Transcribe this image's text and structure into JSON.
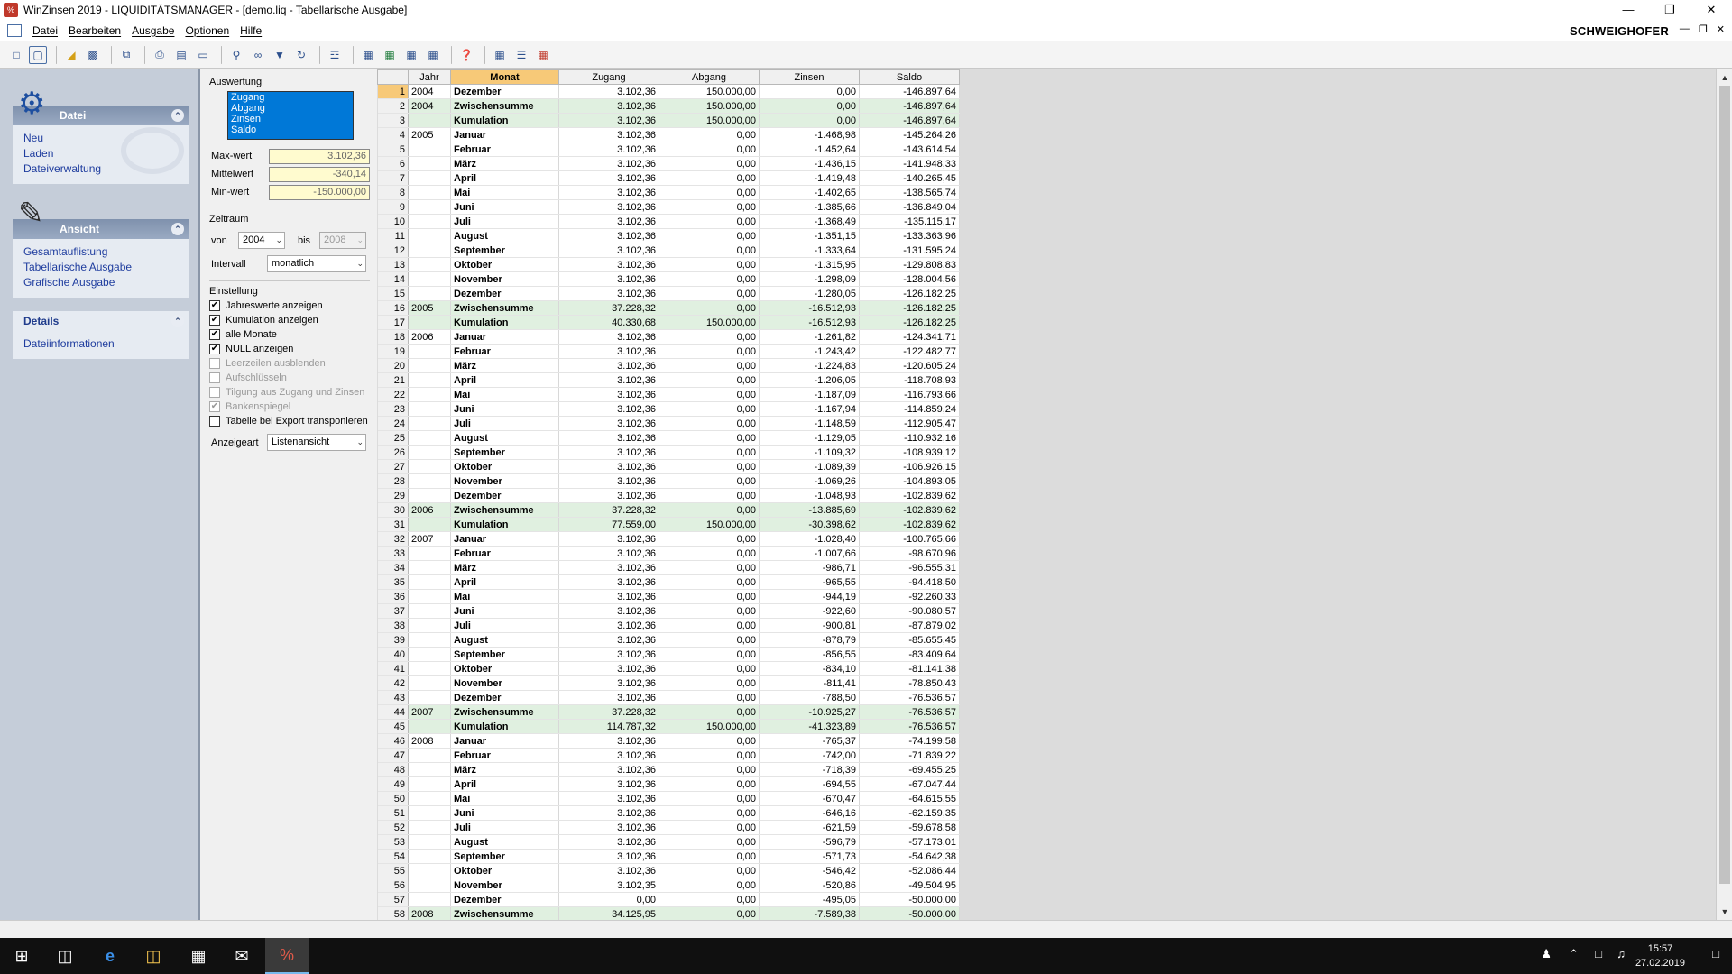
{
  "window": {
    "title": "WinZinsen 2019 - LIQUIDITÄTSMANAGER - [demo.liq - Tabellarische Ausgabe]",
    "app_icon": "%"
  },
  "menu": [
    "Datei",
    "Bearbeiten",
    "Ausgabe",
    "Optionen",
    "Hilfe"
  ],
  "brand": "SCHWEIGHOFER",
  "toolbar_icons": [
    "new-document-icon",
    "page-icon",
    "open-folder-icon",
    "save-icon",
    "copy-icon",
    "print-icon",
    "print-preview-icon",
    "page-setup-icon",
    "search-icon",
    "glasses-icon",
    "filter-icon",
    "refresh-icon",
    "tree-icon",
    "export-icon",
    "excel-export-icon",
    "word-export-icon",
    "pdf-export-icon",
    "help-icon",
    "table-view-icon",
    "list-view-icon",
    "grid-view-icon"
  ],
  "taskpane": {
    "datei": {
      "title": "Datei",
      "items": [
        "Neu",
        "Laden",
        "Dateiverwaltung"
      ]
    },
    "ansicht": {
      "title": "Ansicht",
      "items": [
        "Gesamtauflistung",
        "Tabellarische Ausgabe",
        "Grafische Ausgabe"
      ]
    },
    "details": {
      "title": "Details",
      "items": [
        "Dateiinformationen"
      ]
    }
  },
  "settings": {
    "auswertung_label": "Auswertung",
    "auswertung_items": [
      "Zugang",
      "Abgang",
      "Zinsen",
      "Saldo"
    ],
    "max_label": "Max-wert",
    "max_value": "3.102,36",
    "mittel_label": "Mittelwert",
    "mittel_value": "-340,14",
    "min_label": "Min-wert",
    "min_value": "-150.000,00",
    "zeitraum_label": "Zeitraum",
    "von_label": "von",
    "von_value": "2004",
    "bis_label": "bis",
    "bis_value": "2008",
    "intervall_label": "Intervall",
    "intervall_value": "monatlich",
    "einstellung_label": "Einstellung",
    "checkboxes": [
      {
        "label": "Jahreswerte anzeigen",
        "checked": true,
        "disabled": false
      },
      {
        "label": "Kumulation anzeigen",
        "checked": true,
        "disabled": false
      },
      {
        "label": "alle Monate",
        "checked": true,
        "disabled": false
      },
      {
        "label": "NULL anzeigen",
        "checked": true,
        "disabled": false
      },
      {
        "label": "Leerzeilen ausblenden",
        "checked": false,
        "disabled": true
      },
      {
        "label": "Aufschlüsseln",
        "checked": false,
        "disabled": true
      },
      {
        "label": "Tilgung aus Zugang und Zinsen",
        "checked": false,
        "disabled": true
      },
      {
        "label": "Bankenspiegel",
        "checked": true,
        "disabled": true
      },
      {
        "label": "Tabelle bei Export transponieren",
        "checked": false,
        "disabled": false
      }
    ],
    "anzeigeart_label": "Anzeigeart",
    "anzeigeart_value": "Listenansicht"
  },
  "table": {
    "columns": [
      "",
      "Jahr",
      "Monat",
      "Zugang",
      "Abgang",
      "Zinsen",
      "Saldo"
    ],
    "rows": [
      [
        "1",
        "2004",
        "Dezember",
        "3.102,36",
        "150.000,00",
        "0,00",
        "-146.897,64"
      ],
      [
        "2",
        "2004",
        "Zwischensumme",
        "3.102,36",
        "150.000,00",
        "0,00",
        "-146.897,64"
      ],
      [
        "3",
        "",
        "Kumulation",
        "3.102,36",
        "150.000,00",
        "0,00",
        "-146.897,64"
      ],
      [
        "4",
        "2005",
        "Januar",
        "3.102,36",
        "0,00",
        "-1.468,98",
        "-145.264,26"
      ],
      [
        "5",
        "",
        "Februar",
        "3.102,36",
        "0,00",
        "-1.452,64",
        "-143.614,54"
      ],
      [
        "6",
        "",
        "März",
        "3.102,36",
        "0,00",
        "-1.436,15",
        "-141.948,33"
      ],
      [
        "7",
        "",
        "April",
        "3.102,36",
        "0,00",
        "-1.419,48",
        "-140.265,45"
      ],
      [
        "8",
        "",
        "Mai",
        "3.102,36",
        "0,00",
        "-1.402,65",
        "-138.565,74"
      ],
      [
        "9",
        "",
        "Juni",
        "3.102,36",
        "0,00",
        "-1.385,66",
        "-136.849,04"
      ],
      [
        "10",
        "",
        "Juli",
        "3.102,36",
        "0,00",
        "-1.368,49",
        "-135.115,17"
      ],
      [
        "11",
        "",
        "August",
        "3.102,36",
        "0,00",
        "-1.351,15",
        "-133.363,96"
      ],
      [
        "12",
        "",
        "September",
        "3.102,36",
        "0,00",
        "-1.333,64",
        "-131.595,24"
      ],
      [
        "13",
        "",
        "Oktober",
        "3.102,36",
        "0,00",
        "-1.315,95",
        "-129.808,83"
      ],
      [
        "14",
        "",
        "November",
        "3.102,36",
        "0,00",
        "-1.298,09",
        "-128.004,56"
      ],
      [
        "15",
        "",
        "Dezember",
        "3.102,36",
        "0,00",
        "-1.280,05",
        "-126.182,25"
      ],
      [
        "16",
        "2005",
        "Zwischensumme",
        "37.228,32",
        "0,00",
        "-16.512,93",
        "-126.182,25"
      ],
      [
        "17",
        "",
        "Kumulation",
        "40.330,68",
        "150.000,00",
        "-16.512,93",
        "-126.182,25"
      ],
      [
        "18",
        "2006",
        "Januar",
        "3.102,36",
        "0,00",
        "-1.261,82",
        "-124.341,71"
      ],
      [
        "19",
        "",
        "Februar",
        "3.102,36",
        "0,00",
        "-1.243,42",
        "-122.482,77"
      ],
      [
        "20",
        "",
        "März",
        "3.102,36",
        "0,00",
        "-1.224,83",
        "-120.605,24"
      ],
      [
        "21",
        "",
        "April",
        "3.102,36",
        "0,00",
        "-1.206,05",
        "-118.708,93"
      ],
      [
        "22",
        "",
        "Mai",
        "3.102,36",
        "0,00",
        "-1.187,09",
        "-116.793,66"
      ],
      [
        "23",
        "",
        "Juni",
        "3.102,36",
        "0,00",
        "-1.167,94",
        "-114.859,24"
      ],
      [
        "24",
        "",
        "Juli",
        "3.102,36",
        "0,00",
        "-1.148,59",
        "-112.905,47"
      ],
      [
        "25",
        "",
        "August",
        "3.102,36",
        "0,00",
        "-1.129,05",
        "-110.932,16"
      ],
      [
        "26",
        "",
        "September",
        "3.102,36",
        "0,00",
        "-1.109,32",
        "-108.939,12"
      ],
      [
        "27",
        "",
        "Oktober",
        "3.102,36",
        "0,00",
        "-1.089,39",
        "-106.926,15"
      ],
      [
        "28",
        "",
        "November",
        "3.102,36",
        "0,00",
        "-1.069,26",
        "-104.893,05"
      ],
      [
        "29",
        "",
        "Dezember",
        "3.102,36",
        "0,00",
        "-1.048,93",
        "-102.839,62"
      ],
      [
        "30",
        "2006",
        "Zwischensumme",
        "37.228,32",
        "0,00",
        "-13.885,69",
        "-102.839,62"
      ],
      [
        "31",
        "",
        "Kumulation",
        "77.559,00",
        "150.000,00",
        "-30.398,62",
        "-102.839,62"
      ],
      [
        "32",
        "2007",
        "Januar",
        "3.102,36",
        "0,00",
        "-1.028,40",
        "-100.765,66"
      ],
      [
        "33",
        "",
        "Februar",
        "3.102,36",
        "0,00",
        "-1.007,66",
        "-98.670,96"
      ],
      [
        "34",
        "",
        "März",
        "3.102,36",
        "0,00",
        "-986,71",
        "-96.555,31"
      ],
      [
        "35",
        "",
        "April",
        "3.102,36",
        "0,00",
        "-965,55",
        "-94.418,50"
      ],
      [
        "36",
        "",
        "Mai",
        "3.102,36",
        "0,00",
        "-944,19",
        "-92.260,33"
      ],
      [
        "37",
        "",
        "Juni",
        "3.102,36",
        "0,00",
        "-922,60",
        "-90.080,57"
      ],
      [
        "38",
        "",
        "Juli",
        "3.102,36",
        "0,00",
        "-900,81",
        "-87.879,02"
      ],
      [
        "39",
        "",
        "August",
        "3.102,36",
        "0,00",
        "-878,79",
        "-85.655,45"
      ],
      [
        "40",
        "",
        "September",
        "3.102,36",
        "0,00",
        "-856,55",
        "-83.409,64"
      ],
      [
        "41",
        "",
        "Oktober",
        "3.102,36",
        "0,00",
        "-834,10",
        "-81.141,38"
      ],
      [
        "42",
        "",
        "November",
        "3.102,36",
        "0,00",
        "-811,41",
        "-78.850,43"
      ],
      [
        "43",
        "",
        "Dezember",
        "3.102,36",
        "0,00",
        "-788,50",
        "-76.536,57"
      ],
      [
        "44",
        "2007",
        "Zwischensumme",
        "37.228,32",
        "0,00",
        "-10.925,27",
        "-76.536,57"
      ],
      [
        "45",
        "",
        "Kumulation",
        "114.787,32",
        "150.000,00",
        "-41.323,89",
        "-76.536,57"
      ],
      [
        "46",
        "2008",
        "Januar",
        "3.102,36",
        "0,00",
        "-765,37",
        "-74.199,58"
      ],
      [
        "47",
        "",
        "Februar",
        "3.102,36",
        "0,00",
        "-742,00",
        "-71.839,22"
      ],
      [
        "48",
        "",
        "März",
        "3.102,36",
        "0,00",
        "-718,39",
        "-69.455,25"
      ],
      [
        "49",
        "",
        "April",
        "3.102,36",
        "0,00",
        "-694,55",
        "-67.047,44"
      ],
      [
        "50",
        "",
        "Mai",
        "3.102,36",
        "0,00",
        "-670,47",
        "-64.615,55"
      ],
      [
        "51",
        "",
        "Juni",
        "3.102,36",
        "0,00",
        "-646,16",
        "-62.159,35"
      ],
      [
        "52",
        "",
        "Juli",
        "3.102,36",
        "0,00",
        "-621,59",
        "-59.678,58"
      ],
      [
        "53",
        "",
        "August",
        "3.102,36",
        "0,00",
        "-596,79",
        "-57.173,01"
      ],
      [
        "54",
        "",
        "September",
        "3.102,36",
        "0,00",
        "-571,73",
        "-54.642,38"
      ],
      [
        "55",
        "",
        "Oktober",
        "3.102,36",
        "0,00",
        "-546,42",
        "-52.086,44"
      ],
      [
        "56",
        "",
        "November",
        "3.102,35",
        "0,00",
        "-520,86",
        "-49.504,95"
      ],
      [
        "57",
        "",
        "Dezember",
        "0,00",
        "0,00",
        "-495,05",
        "-50.000,00"
      ],
      [
        "58",
        "2008",
        "Zwischensumme",
        "34.125,95",
        "0,00",
        "-7.589,38",
        "-50.000,00"
      ]
    ]
  },
  "taskbar": {
    "time": "15:57",
    "date": "27.02.2019"
  }
}
